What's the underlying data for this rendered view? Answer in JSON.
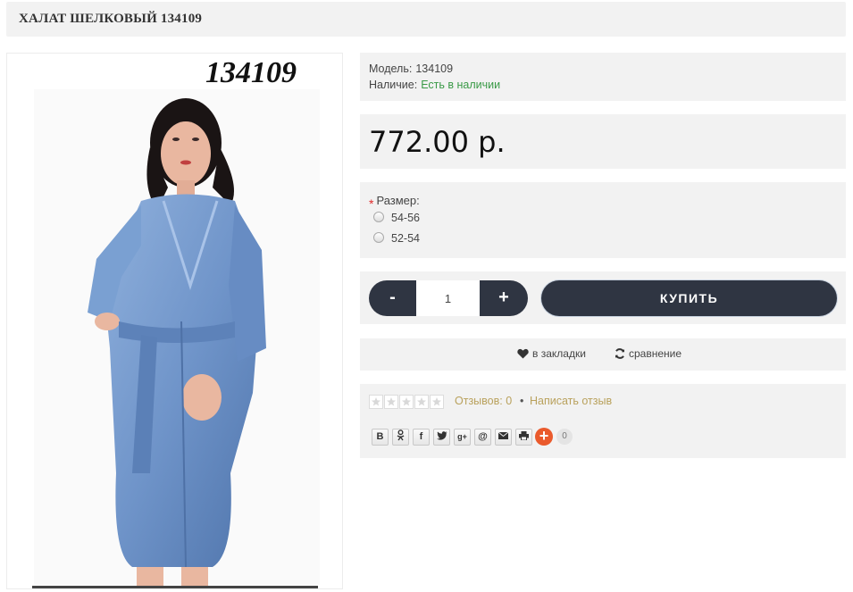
{
  "page": {
    "title": "ХАЛАТ ШЕЛКОВЫЙ 134109"
  },
  "photo": {
    "label": "134109",
    "alt_subject": "blue satin robe",
    "robe_color": "#6f94c9"
  },
  "info": {
    "model_label": "Модель:",
    "model_value": "134109",
    "stock_label": "Наличие:",
    "stock_value": "Есть в наличии"
  },
  "price": "772.00 р.",
  "options": {
    "required_mark": "*",
    "label": "Размер:",
    "sizes": [
      "54-56",
      "52-54"
    ]
  },
  "cart": {
    "minus_label": "-",
    "quantity": "1",
    "plus_label": "+",
    "buy_label": "КУПИТЬ"
  },
  "actions": {
    "wishlist_label": "в закладки",
    "compare_label": "сравнение"
  },
  "reviews": {
    "rating_stars": 0,
    "max_stars": 5,
    "count_label": "Отзывов: 0",
    "separator": "•",
    "write_label": "Написать отзыв"
  },
  "share": {
    "buttons": [
      "В",
      "ok-icon",
      "f",
      "twitter-icon",
      "g+",
      "@",
      "mail-icon",
      "print-icon"
    ],
    "more_label": "+",
    "count": "0"
  },
  "colors": {
    "panel_bg": "#f2f2f2",
    "dark_button": "#2f3542",
    "stock_green": "#3a9a47",
    "link_gold": "#b9a15c",
    "share_orange": "#ea5a2c"
  }
}
